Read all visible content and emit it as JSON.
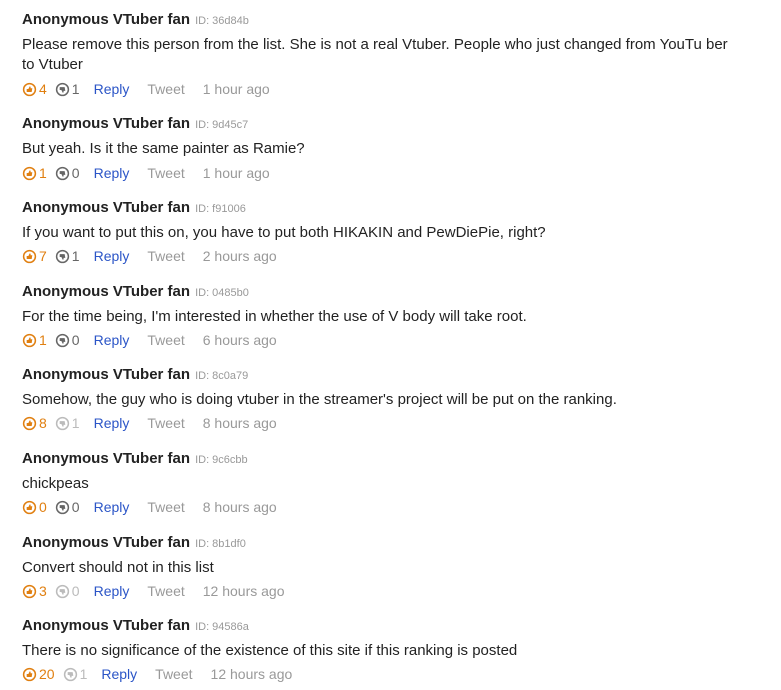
{
  "theme": {
    "good_color": "#e07f10",
    "bad_color": "#666666",
    "bad_dim_color": "#bbbbbb",
    "reply_color": "#2b55c7",
    "meta_color": "#999999"
  },
  "icons": {
    "good": "thumbs-up-icon",
    "bad": "thumbs-down-icon"
  },
  "comments": [
    {
      "author": "Anonymous VTuber fan",
      "id": "ID: 36d84b",
      "text": "Please remove this person from the list. She is not a real Vtuber. People who just changed from YouTu ber to Vtuber",
      "good": "4",
      "bad": "1",
      "reply": "Reply",
      "tweet": "Tweet",
      "time": "1 hour ago"
    },
    {
      "author": "Anonymous VTuber fan",
      "id": "ID: 9d45c7",
      "text": "But yeah. Is it the same painter as Ramie?",
      "good": "1",
      "bad": "0",
      "reply": "Reply",
      "tweet": "Tweet",
      "time": "1 hour ago"
    },
    {
      "author": "Anonymous VTuber fan",
      "id": "ID: f91006",
      "text": "If you want to put this on, you have to put both HIKAKIN and PewDiePie, right?",
      "good": "7",
      "bad": "1",
      "reply": "Reply",
      "tweet": "Tweet",
      "time": "2 hours ago"
    },
    {
      "author": "Anonymous VTuber fan",
      "id": "ID: 0485b0",
      "text": "For the time being, I'm interested in whether the use of V body will take root.",
      "good": "1",
      "bad": "0",
      "reply": "Reply",
      "tweet": "Tweet",
      "time": "6 hours ago"
    },
    {
      "author": "Anonymous VTuber fan",
      "id": "ID: 8c0a79",
      "text": "Somehow, the guy who is doing vtuber in the streamer's project will be put on the ranking.",
      "good": "8",
      "bad": "1",
      "reply": "Reply",
      "tweet": "Tweet",
      "time": "8 hours ago"
    },
    {
      "author": "Anonymous VTuber fan",
      "id": "ID: 9c6cbb",
      "text": "chickpeas",
      "good": "0",
      "bad": "0",
      "reply": "Reply",
      "tweet": "Tweet",
      "time": "8 hours ago"
    },
    {
      "author": "Anonymous VTuber fan",
      "id": "ID: 8b1df0",
      "text": "Convert should not in this list",
      "good": "3",
      "bad": "0",
      "reply": "Reply",
      "tweet": "Tweet",
      "time": "12 hours ago"
    },
    {
      "author": "Anonymous VTuber fan",
      "id": "ID: 94586a",
      "text": "There is no significance of the existence of this site if this ranking is posted",
      "good": "20",
      "bad": "1",
      "reply": "Reply",
      "tweet": "Tweet",
      "time": "12 hours ago"
    }
  ]
}
